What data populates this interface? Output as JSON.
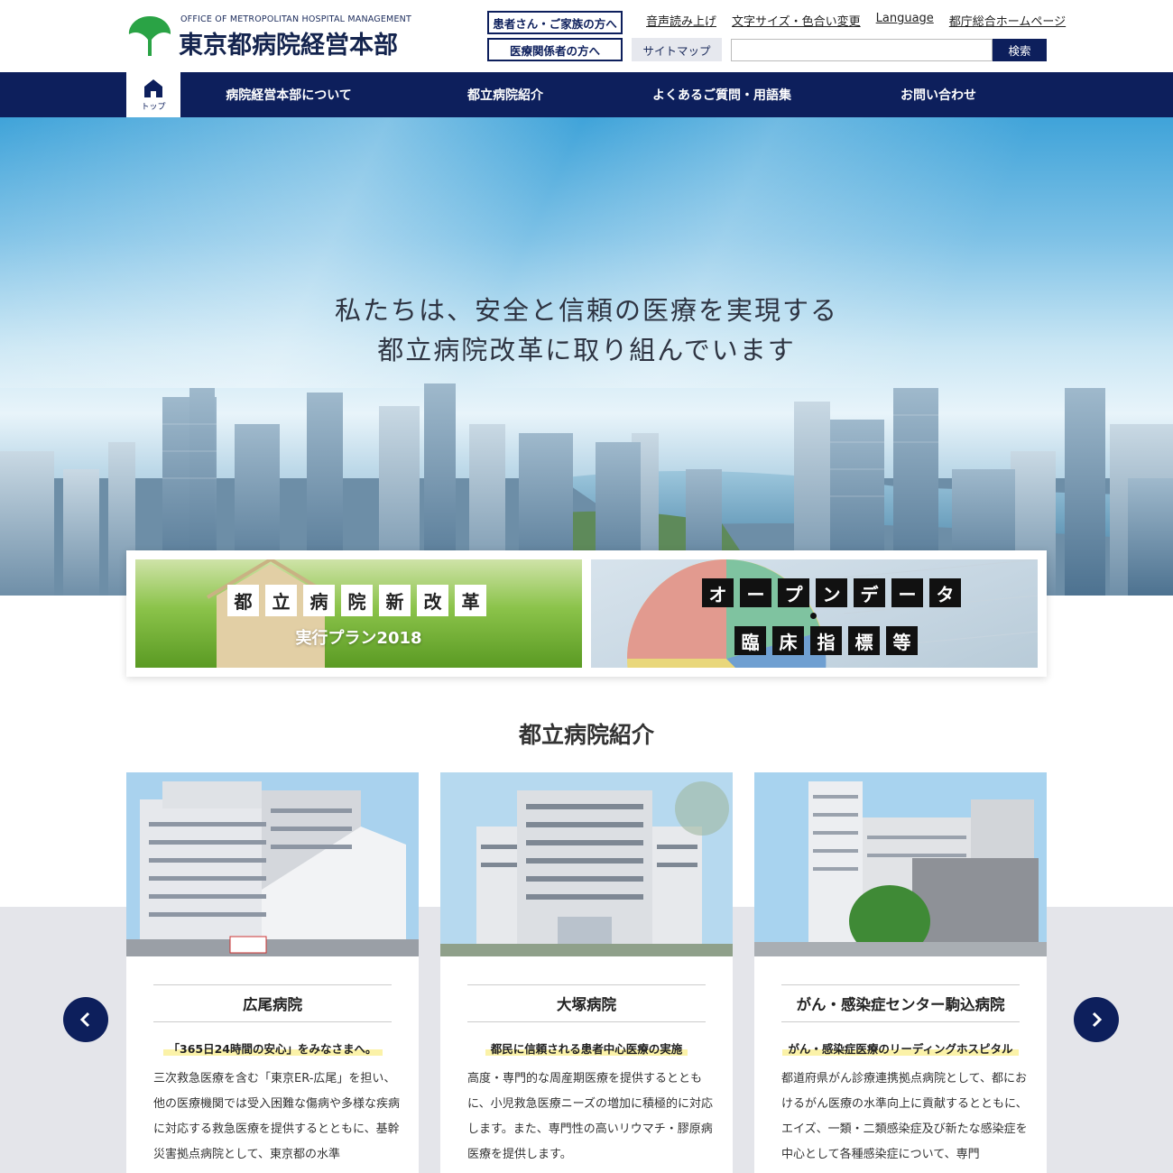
{
  "header": {
    "logo_en": "OFFICE OF METROPOLITAN HOSPITAL MANAGEMENT",
    "logo_ja": "東京都病院経営本部",
    "patient_button": "患者さん・ご家族の方へ",
    "medical_button": "医療関係者の方へ",
    "sitemap_button": "サイトマップ",
    "util_links": [
      "音声読み上げ",
      "文字サイズ・色合い変更",
      "Language",
      "都庁総合ホームページ"
    ],
    "search_placeholder": "",
    "search_button": "検索"
  },
  "nav": {
    "home_label": "トップ",
    "items": [
      "病院経営本部について",
      "都立病院紹介",
      "よくあるご質問・用語集",
      "お問い合わせ"
    ]
  },
  "hero": {
    "line1": "私たちは、安全と信頼の医療を実現する",
    "line2": "都立病院改革に取り組んでいます"
  },
  "banners": {
    "left_tiles": [
      "都",
      "立",
      "病",
      "院",
      "新",
      "改",
      "革"
    ],
    "left_sub": "実行プラン2018",
    "right_tiles_top": [
      "オ",
      "ー",
      "プ",
      "ン",
      "デ",
      "ー",
      "タ"
    ],
    "right_tiles_bottom": [
      "臨",
      "床",
      "指",
      "標",
      "等"
    ]
  },
  "section": {
    "title": "都立病院紹介"
  },
  "cards": [
    {
      "name": "広尾病院",
      "tag": "「365日24時間の安心」をみなさまへ。",
      "desc": "三次救急医療を含む「東京ER-広尾」を担い、他の医療機関では受入困難な傷病や多様な疾病に対応する救急医療を提供するとともに、基幹災害拠点病院として、東京都の水準"
    },
    {
      "name": "大塚病院",
      "tag": "都民に信頼される患者中心医療の実施",
      "desc": "高度・専門的な周産期医療を提供するとともに、小児救急医療ニーズの増加に積極的に対応します。また、専門性の高いリウマチ・膠原病医療を提供します。"
    },
    {
      "name": "がん・感染症センター駒込病院",
      "tag": "がん・感染症医療のリーディングホスピタル",
      "desc": "都道府県がん診療連携拠点病院として、都におけるがん医療の水準向上に貢献するとともに、エイズ、一類・二類感染症及び新たな感染症を中心として各種感染症について、専門"
    }
  ],
  "colors": {
    "navy": "#0d1f5c",
    "logo_green": "#2aa345",
    "highlight": "#fbf2a8"
  }
}
